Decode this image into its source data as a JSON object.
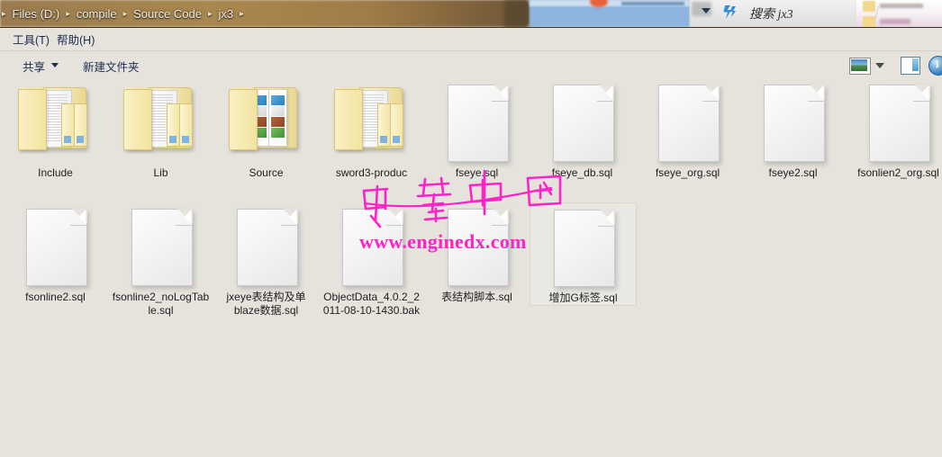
{
  "window": {
    "address_bar": {
      "crumbs": [
        "Files (D:)",
        "compile",
        "Source Code",
        "jx3"
      ],
      "separator": "▸",
      "dropdown_icon": "chevron-down-icon",
      "refresh_icon": "refresh-icon"
    },
    "search": {
      "value": "搜索 jx3",
      "icon": "search-icon"
    }
  },
  "menubar": {
    "items": [
      {
        "label": "工具(T)",
        "accel": "T"
      },
      {
        "label": "帮助(H)",
        "accel": "H"
      }
    ]
  },
  "toolbar": {
    "share_label": "共享",
    "new_folder_label": "新建文件夹",
    "view_icon": "picture-view-icon",
    "view_caret_icon": "chevron-down-icon",
    "preview_pane_icon": "preview-pane-icon",
    "help_icon": "help-info-icon"
  },
  "colors": {
    "background": "#e6e3dd",
    "folder": "#f2e5a4",
    "watermark": "#ff22c8",
    "menu_text": "#1b2b50"
  },
  "files": [
    {
      "name": "Include",
      "type": "folder",
      "icon": "folder-icon",
      "selected": false
    },
    {
      "name": "Lib",
      "type": "folder",
      "icon": "folder-icon",
      "selected": false
    },
    {
      "name": "Source",
      "type": "folder-books",
      "icon": "folder-books-icon",
      "selected": false
    },
    {
      "name": "sword3-produc",
      "type": "folder",
      "icon": "folder-icon",
      "selected": false
    },
    {
      "name": "fseye.sql",
      "type": "file",
      "icon": "sql-file-icon",
      "selected": false
    },
    {
      "name": "fseye_db.sql",
      "type": "file",
      "icon": "sql-file-icon",
      "selected": false
    },
    {
      "name": "fseye_org.sql",
      "type": "file",
      "icon": "sql-file-icon",
      "selected": false
    },
    {
      "name": "fseye2.sql",
      "type": "file",
      "icon": "sql-file-icon",
      "selected": false
    },
    {
      "name": "fsonlien2_org.sql",
      "type": "file",
      "icon": "sql-file-icon",
      "selected": false
    },
    {
      "name": "fsonline2.sql",
      "type": "file",
      "icon": "sql-file-icon",
      "selected": false
    },
    {
      "name": "fsonline2_noLogTable.sql",
      "type": "file",
      "icon": "sql-file-icon",
      "selected": false
    },
    {
      "name": "jxeye表结构及单blaze数据.sql",
      "type": "file",
      "icon": "sql-file-icon",
      "selected": false
    },
    {
      "name": "ObjectData_4.0.2_2011-08-10-1430.bak",
      "type": "file",
      "icon": "bak-file-icon",
      "selected": false
    },
    {
      "name": "表结构脚本.sql",
      "type": "file",
      "icon": "sql-file-icon",
      "selected": false
    },
    {
      "name": "增加G标签.sql",
      "type": "file",
      "icon": "sql-file-icon",
      "selected": true
    }
  ],
  "watermark": {
    "handwriting": "引擎中国",
    "url": "www.enginedx.com"
  }
}
